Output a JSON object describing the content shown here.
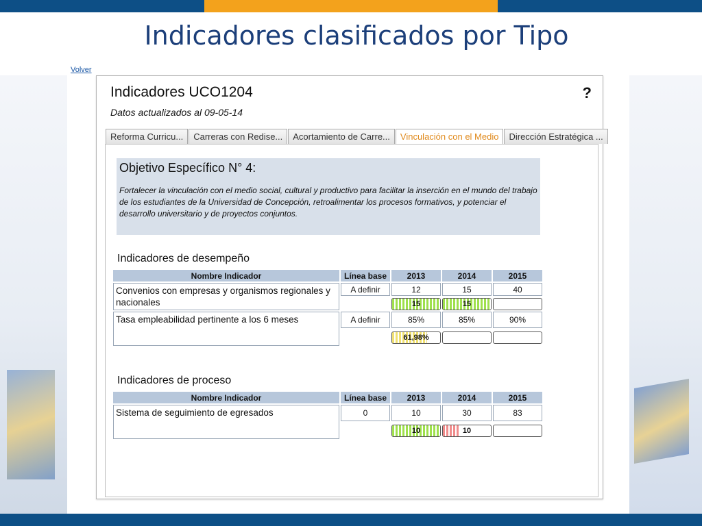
{
  "slide": {
    "title": "Indicadores clasificados por Tipo",
    "volver": "Volver"
  },
  "window": {
    "title": "Indicadores UCO1204",
    "help": "?",
    "date_label": "Datos actualizados al",
    "date_value": "09-05-14"
  },
  "tabs": [
    {
      "label": "Reforma Curricu...",
      "active": false
    },
    {
      "label": "Carreras con Redise...",
      "active": false
    },
    {
      "label": "Acortamiento de Carre...",
      "active": false
    },
    {
      "label": "Vinculación con el Medio",
      "active": true
    },
    {
      "label": "Dirección Estratégica ...",
      "active": false
    }
  ],
  "objective": {
    "title": "Objetivo Específico N° 4:",
    "text": "Fortalecer la vinculación con el medio social, cultural y productivo para facilitar la inserción en el mundo del trabajo de los estudiantes de la Universidad de Concepción, retroalimentar los procesos formativos, y potenciar el desarrollo universitario y de proyectos conjuntos."
  },
  "columns": {
    "name": "Nombre Indicador",
    "baseline": "Línea base",
    "y1": "2013",
    "y2": "2014",
    "y3": "2015"
  },
  "desempeno": {
    "title": "Indicadores de desempeño",
    "rows": [
      {
        "name": "Convenios con empresas y organismos regionales y nacionales",
        "baseline": "A definir",
        "t2013": "12",
        "t2014": "15",
        "t2015": "40",
        "m2013": "15",
        "m2013_color": "green",
        "m2013_fill": 1.0,
        "m2014": "15",
        "m2014_color": "green",
        "m2014_fill": 1.0,
        "m2015": "",
        "m2015_fill": 0
      },
      {
        "name": "Tasa empleabilidad pertinente a los 6 meses",
        "baseline": "A definir",
        "t2013": "85%",
        "t2014": "85%",
        "t2015": "90%",
        "m2013": "61,98%",
        "m2013_color": "yellow",
        "m2013_fill": 0.73,
        "m2014": "",
        "m2014_fill": 0,
        "m2015": "",
        "m2015_fill": 0
      }
    ]
  },
  "proceso": {
    "title": "Indicadores de proceso",
    "rows": [
      {
        "name": "Sistema de seguimiento de egresados",
        "baseline": "0",
        "t2013": "10",
        "t2014": "30",
        "t2015": "83",
        "m2013": "10",
        "m2013_color": "green",
        "m2013_fill": 1.0,
        "m2014": "10",
        "m2014_color": "red",
        "m2014_fill": 0.33,
        "m2015": "",
        "m2015_fill": 0
      }
    ]
  },
  "colors": {
    "brand_blue": "#0d4f86",
    "brand_orange": "#f3a21c",
    "title_blue": "#1c3f7a",
    "active_tab": "#e08a1c",
    "header_fill": "#b7c7db",
    "objective_fill": "#d8e0ea"
  }
}
